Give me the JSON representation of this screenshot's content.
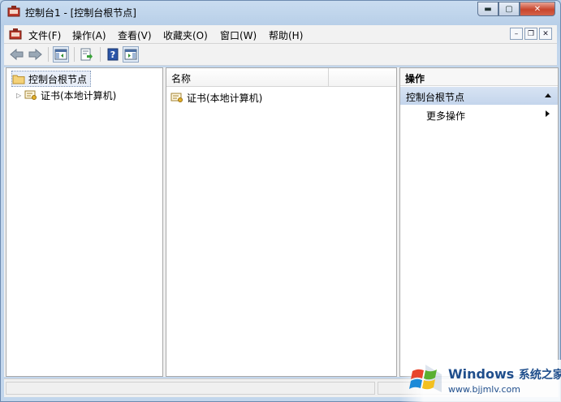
{
  "window": {
    "title": "控制台1 - [控制台根节点]",
    "caption": {
      "minimize": "▬",
      "maximize": "▢",
      "close": "✕"
    }
  },
  "menubar": {
    "items": [
      {
        "label": "文件(F)"
      },
      {
        "label": "操作(A)"
      },
      {
        "label": "查看(V)"
      },
      {
        "label": "收藏夹(O)"
      },
      {
        "label": "窗口(W)"
      },
      {
        "label": "帮助(H)"
      }
    ],
    "mdi": {
      "minimize": "–",
      "restore": "❐",
      "close": "✕"
    }
  },
  "toolbar": {
    "buttons": [
      {
        "icon": "back-arrow-icon"
      },
      {
        "icon": "forward-arrow-icon"
      },
      {
        "icon": "show-hide-console-tree-icon"
      },
      {
        "icon": "export-list-icon"
      },
      {
        "icon": "help-icon"
      },
      {
        "icon": "show-hide-action-pane-icon"
      }
    ]
  },
  "tree": {
    "root_label": "控制台根节点",
    "children": [
      {
        "label": "证书(本地计算机)"
      }
    ]
  },
  "list": {
    "column_name": "名称",
    "rows": [
      {
        "label": "证书(本地计算机)"
      }
    ]
  },
  "actions": {
    "header": "操作",
    "group_label": "控制台根节点",
    "items": [
      {
        "label": "更多操作"
      }
    ]
  },
  "watermark": {
    "brand": "Windows",
    "brand_suffix": "系统之家",
    "url": "www.bjjmlv.com"
  },
  "colors": {
    "accent": "#1f4e8c",
    "actions_group_bg": "#c4d5ec",
    "close_button": "#c8452c"
  }
}
